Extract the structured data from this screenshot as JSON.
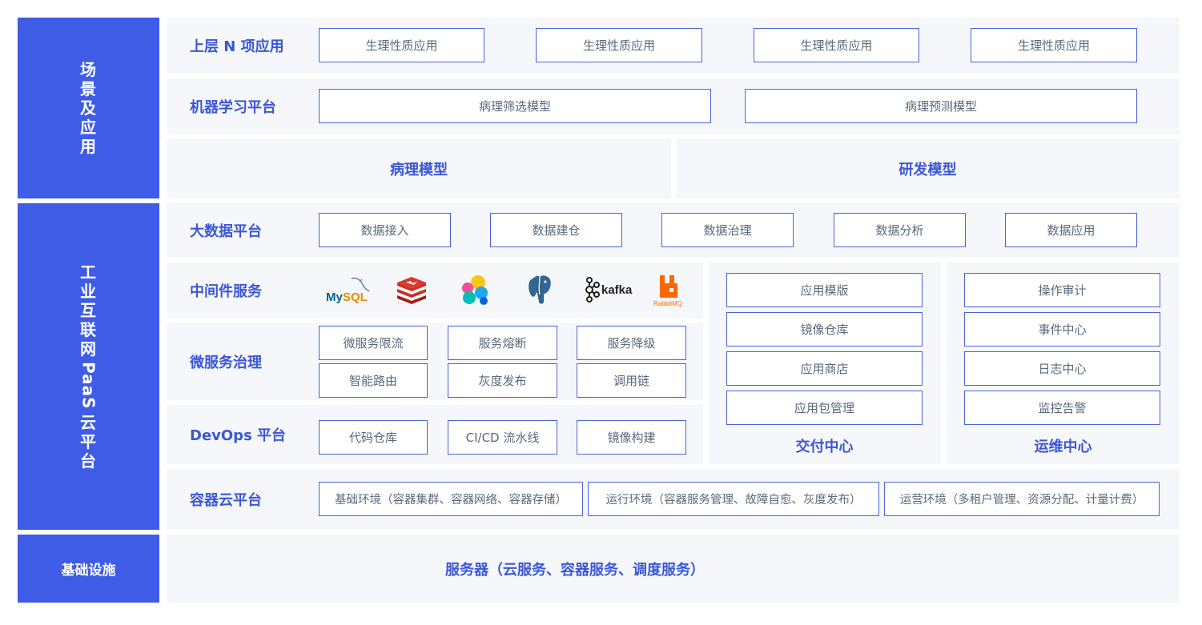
{
  "left_column": {
    "scene": [
      "场",
      "景",
      "及",
      "应",
      "用"
    ],
    "paas": [
      "工",
      "业",
      "互",
      "联",
      "网",
      "PaaS",
      "云",
      "平",
      "台"
    ],
    "infra": "基础设施"
  },
  "upper_apps": {
    "label": "上层 N 项应用",
    "items": [
      "生理性质应用",
      "生理性质应用",
      "生理性质应用",
      "生理性质应用"
    ]
  },
  "ml_platform": {
    "label": "机器学习平台",
    "items": [
      "病理筛选模型",
      "病理预测模型"
    ]
  },
  "models": {
    "left": "病理模型",
    "right": "研发模型"
  },
  "big_data": {
    "label": "大数据平台",
    "items": [
      "数据接入",
      "数据建仓",
      "数据治理",
      "数据分析",
      "数据应用"
    ]
  },
  "middleware": {
    "label": "中间件服务",
    "icons": [
      "mysql-icon",
      "redis-icon",
      "elasticsearch-icon",
      "postgresql-icon",
      "kafka-icon",
      "rabbitmq-icon"
    ],
    "mysql_text": "MySQL",
    "kafka_text": "kafka",
    "rabbitmq_text": "RabbitMQ"
  },
  "microservice": {
    "label": "微服务治理",
    "items": [
      "微服务限流",
      "服务熔断",
      "服务降级",
      "智能路由",
      "灰度发布",
      "调用链"
    ]
  },
  "devops": {
    "label": "DevOps 平台",
    "items": [
      "代码仓库",
      "CI/CD 流水线",
      "镜像构建"
    ]
  },
  "delivery": {
    "title": "交付中心",
    "items": [
      "应用模版",
      "镜像仓库",
      "应用商店",
      "应用包管理"
    ]
  },
  "ops": {
    "title": "运维中心",
    "items": [
      "操作审计",
      "事件中心",
      "日志中心",
      "监控告警"
    ]
  },
  "container": {
    "label": "容器云平台",
    "items": [
      "基础环境（容器集群、容器网络、容器存储）",
      "运行环境（容器服务管理、故障自愈、灰度发布）",
      "运营环境（多租户管理、资源分配、计量计费）"
    ]
  },
  "infra_row": {
    "text": "服务器（云服务、容器服务、调度服务）"
  },
  "colors": {
    "accent": "#3f5ce6",
    "panel": "#f6f7fa",
    "box_border": "#4a63d8"
  }
}
